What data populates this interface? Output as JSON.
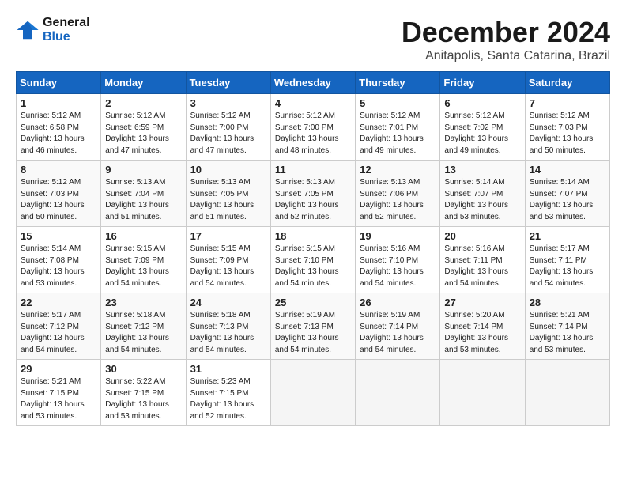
{
  "logo": {
    "line1": "General",
    "line2": "Blue"
  },
  "title": "December 2024",
  "location": "Anitapolis, Santa Catarina, Brazil",
  "weekdays": [
    "Sunday",
    "Monday",
    "Tuesday",
    "Wednesday",
    "Thursday",
    "Friday",
    "Saturday"
  ],
  "weeks": [
    [
      {
        "day": "1",
        "info": "Sunrise: 5:12 AM\nSunset: 6:58 PM\nDaylight: 13 hours\nand 46 minutes."
      },
      {
        "day": "2",
        "info": "Sunrise: 5:12 AM\nSunset: 6:59 PM\nDaylight: 13 hours\nand 47 minutes."
      },
      {
        "day": "3",
        "info": "Sunrise: 5:12 AM\nSunset: 7:00 PM\nDaylight: 13 hours\nand 47 minutes."
      },
      {
        "day": "4",
        "info": "Sunrise: 5:12 AM\nSunset: 7:00 PM\nDaylight: 13 hours\nand 48 minutes."
      },
      {
        "day": "5",
        "info": "Sunrise: 5:12 AM\nSunset: 7:01 PM\nDaylight: 13 hours\nand 49 minutes."
      },
      {
        "day": "6",
        "info": "Sunrise: 5:12 AM\nSunset: 7:02 PM\nDaylight: 13 hours\nand 49 minutes."
      },
      {
        "day": "7",
        "info": "Sunrise: 5:12 AM\nSunset: 7:03 PM\nDaylight: 13 hours\nand 50 minutes."
      }
    ],
    [
      {
        "day": "8",
        "info": "Sunrise: 5:12 AM\nSunset: 7:03 PM\nDaylight: 13 hours\nand 50 minutes."
      },
      {
        "day": "9",
        "info": "Sunrise: 5:13 AM\nSunset: 7:04 PM\nDaylight: 13 hours\nand 51 minutes."
      },
      {
        "day": "10",
        "info": "Sunrise: 5:13 AM\nSunset: 7:05 PM\nDaylight: 13 hours\nand 51 minutes."
      },
      {
        "day": "11",
        "info": "Sunrise: 5:13 AM\nSunset: 7:05 PM\nDaylight: 13 hours\nand 52 minutes."
      },
      {
        "day": "12",
        "info": "Sunrise: 5:13 AM\nSunset: 7:06 PM\nDaylight: 13 hours\nand 52 minutes."
      },
      {
        "day": "13",
        "info": "Sunrise: 5:14 AM\nSunset: 7:07 PM\nDaylight: 13 hours\nand 53 minutes."
      },
      {
        "day": "14",
        "info": "Sunrise: 5:14 AM\nSunset: 7:07 PM\nDaylight: 13 hours\nand 53 minutes."
      }
    ],
    [
      {
        "day": "15",
        "info": "Sunrise: 5:14 AM\nSunset: 7:08 PM\nDaylight: 13 hours\nand 53 minutes."
      },
      {
        "day": "16",
        "info": "Sunrise: 5:15 AM\nSunset: 7:09 PM\nDaylight: 13 hours\nand 54 minutes."
      },
      {
        "day": "17",
        "info": "Sunrise: 5:15 AM\nSunset: 7:09 PM\nDaylight: 13 hours\nand 54 minutes."
      },
      {
        "day": "18",
        "info": "Sunrise: 5:15 AM\nSunset: 7:10 PM\nDaylight: 13 hours\nand 54 minutes."
      },
      {
        "day": "19",
        "info": "Sunrise: 5:16 AM\nSunset: 7:10 PM\nDaylight: 13 hours\nand 54 minutes."
      },
      {
        "day": "20",
        "info": "Sunrise: 5:16 AM\nSunset: 7:11 PM\nDaylight: 13 hours\nand 54 minutes."
      },
      {
        "day": "21",
        "info": "Sunrise: 5:17 AM\nSunset: 7:11 PM\nDaylight: 13 hours\nand 54 minutes."
      }
    ],
    [
      {
        "day": "22",
        "info": "Sunrise: 5:17 AM\nSunset: 7:12 PM\nDaylight: 13 hours\nand 54 minutes."
      },
      {
        "day": "23",
        "info": "Sunrise: 5:18 AM\nSunset: 7:12 PM\nDaylight: 13 hours\nand 54 minutes."
      },
      {
        "day": "24",
        "info": "Sunrise: 5:18 AM\nSunset: 7:13 PM\nDaylight: 13 hours\nand 54 minutes."
      },
      {
        "day": "25",
        "info": "Sunrise: 5:19 AM\nSunset: 7:13 PM\nDaylight: 13 hours\nand 54 minutes."
      },
      {
        "day": "26",
        "info": "Sunrise: 5:19 AM\nSunset: 7:14 PM\nDaylight: 13 hours\nand 54 minutes."
      },
      {
        "day": "27",
        "info": "Sunrise: 5:20 AM\nSunset: 7:14 PM\nDaylight: 13 hours\nand 53 minutes."
      },
      {
        "day": "28",
        "info": "Sunrise: 5:21 AM\nSunset: 7:14 PM\nDaylight: 13 hours\nand 53 minutes."
      }
    ],
    [
      {
        "day": "29",
        "info": "Sunrise: 5:21 AM\nSunset: 7:15 PM\nDaylight: 13 hours\nand 53 minutes."
      },
      {
        "day": "30",
        "info": "Sunrise: 5:22 AM\nSunset: 7:15 PM\nDaylight: 13 hours\nand 53 minutes."
      },
      {
        "day": "31",
        "info": "Sunrise: 5:23 AM\nSunset: 7:15 PM\nDaylight: 13 hours\nand 52 minutes."
      },
      {
        "day": "",
        "info": ""
      },
      {
        "day": "",
        "info": ""
      },
      {
        "day": "",
        "info": ""
      },
      {
        "day": "",
        "info": ""
      }
    ]
  ]
}
